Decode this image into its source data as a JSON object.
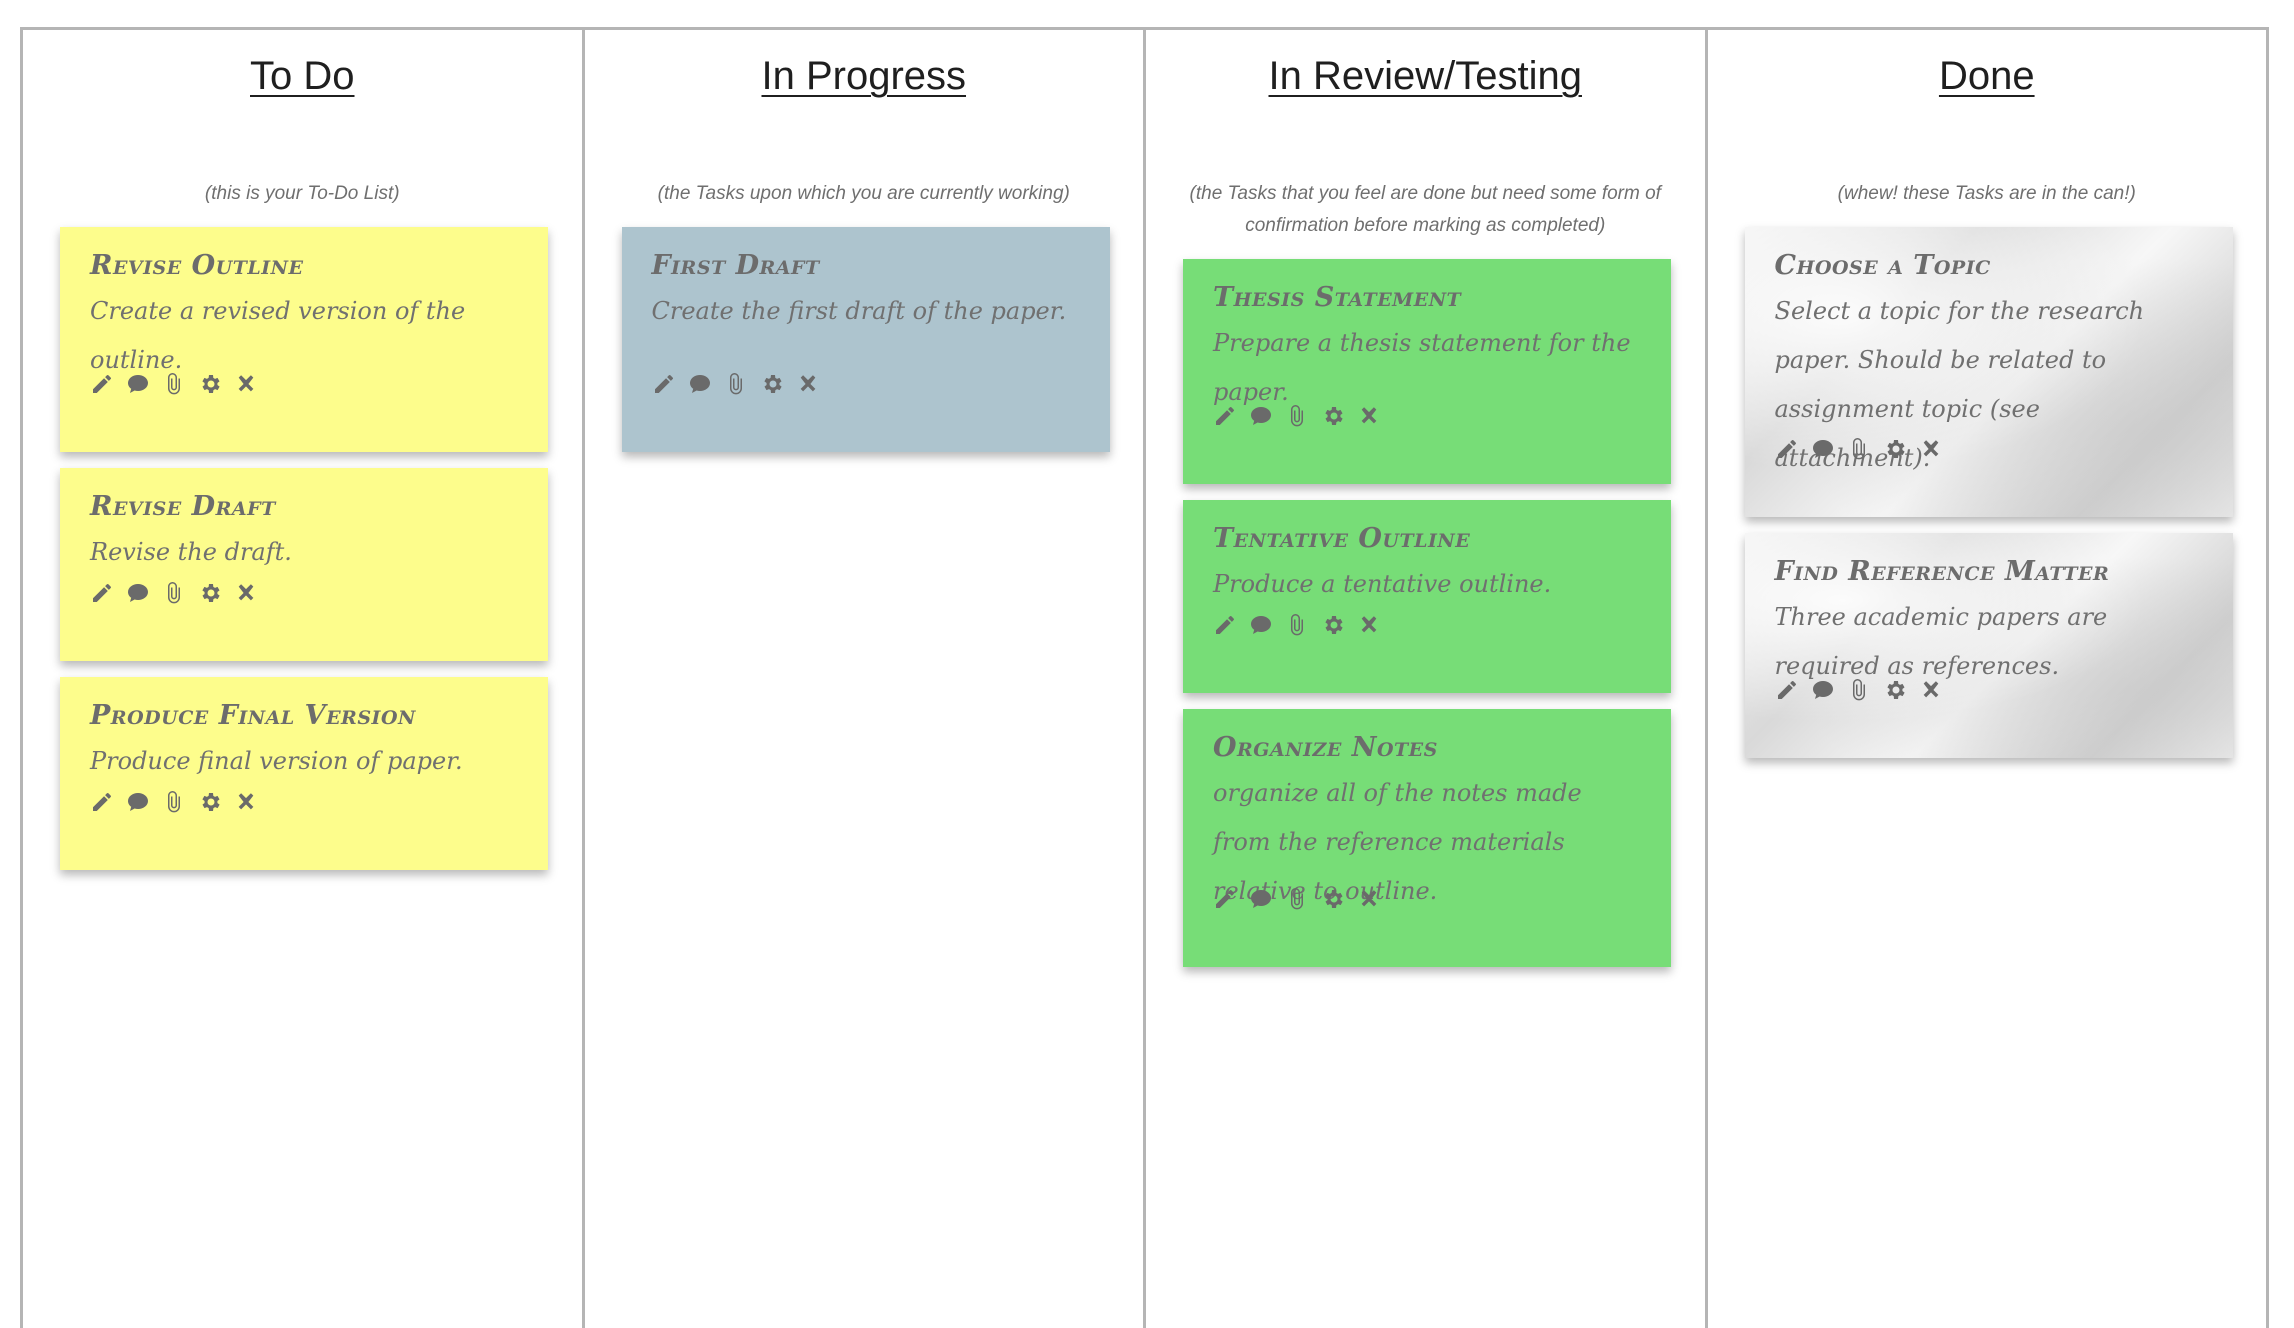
{
  "columns": [
    {
      "title": "To Do",
      "subtitle": "(this is your To-Do List)",
      "cards": [
        {
          "title": "Revise Outline",
          "description": "Create a revised version of the outline."
        },
        {
          "title": "Revise Draft",
          "description": "Revise the draft."
        },
        {
          "title": "Produce Final Version",
          "description": "Produce final version of paper."
        }
      ]
    },
    {
      "title": "In Progress",
      "subtitle": "(the Tasks upon which you are currently working)",
      "cards": [
        {
          "title": "First Draft",
          "description": "Create the first draft of the paper."
        }
      ]
    },
    {
      "title": "In Review/Testing",
      "subtitle": "(the Tasks that you feel are done but need some form of confirmation before marking as completed)",
      "cards": [
        {
          "title": "Thesis Statement",
          "description": "Prepare a thesis statement for the paper."
        },
        {
          "title": "Tentative Outline",
          "description": "Produce a tentative outline."
        },
        {
          "title": "Organize Notes",
          "description": "organize all of the notes made from the reference materials relative to outline."
        }
      ]
    },
    {
      "title": "Done",
      "subtitle": "(whew! these Tasks are in the can!)",
      "cards": [
        {
          "title": "Choose a Topic",
          "description": "Select a topic for the research paper. Should be related to assignment topic (see attachment)."
        },
        {
          "title": "Find Reference Matter",
          "description": "Three academic papers are required as references."
        }
      ]
    }
  ],
  "card_icons": [
    "pencil-icon",
    "comment-icon",
    "paperclip-icon",
    "gear-icon",
    "close-icon"
  ],
  "colors": {
    "todo_card": "#fdfd8c",
    "in_progress_card": "#adc4ce",
    "review_card": "#77dd77",
    "done_card": "#e6e6e6"
  }
}
